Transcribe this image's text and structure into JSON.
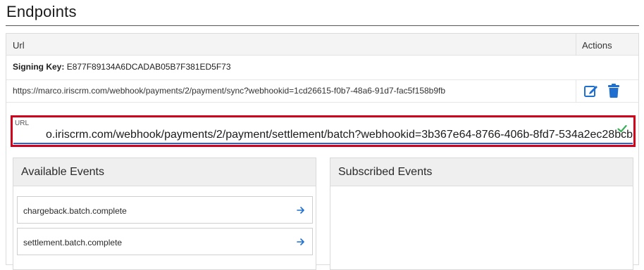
{
  "page": {
    "title": "Endpoints"
  },
  "table": {
    "col_url": "Url",
    "col_actions": "Actions",
    "signing_key_label": "Signing Key:",
    "signing_key_value": "E877F89134A6DCADAB05B7F381ED5F73",
    "endpoint_url": "https://marco.iriscrm.com/webhook/payments/2/payment/sync?webhookid=1cd26615-f0b7-48a6-91d7-fac5f158b9fb"
  },
  "url_field": {
    "label": "URL",
    "value": "o.iriscrm.com/webhook/payments/2/payment/settlement/batch?webhookid=3b367e64-8766-406b-8fd7-534a2ec28bcb"
  },
  "available": {
    "title": "Available Events",
    "items": [
      {
        "label": "chargeback.batch.complete"
      },
      {
        "label": "settlement.batch.complete"
      }
    ]
  },
  "subscribed": {
    "title": "Subscribed Events"
  },
  "icons": {
    "edit": "edit-icon",
    "trash": "trash-icon",
    "check": "check-icon",
    "arrow": "arrow-right-icon"
  },
  "colors": {
    "accent_blue": "#1f6fd1",
    "highlight_red": "#d0021b",
    "check_green": "#3cae5a",
    "underline_blue": "#3b5ccc"
  }
}
